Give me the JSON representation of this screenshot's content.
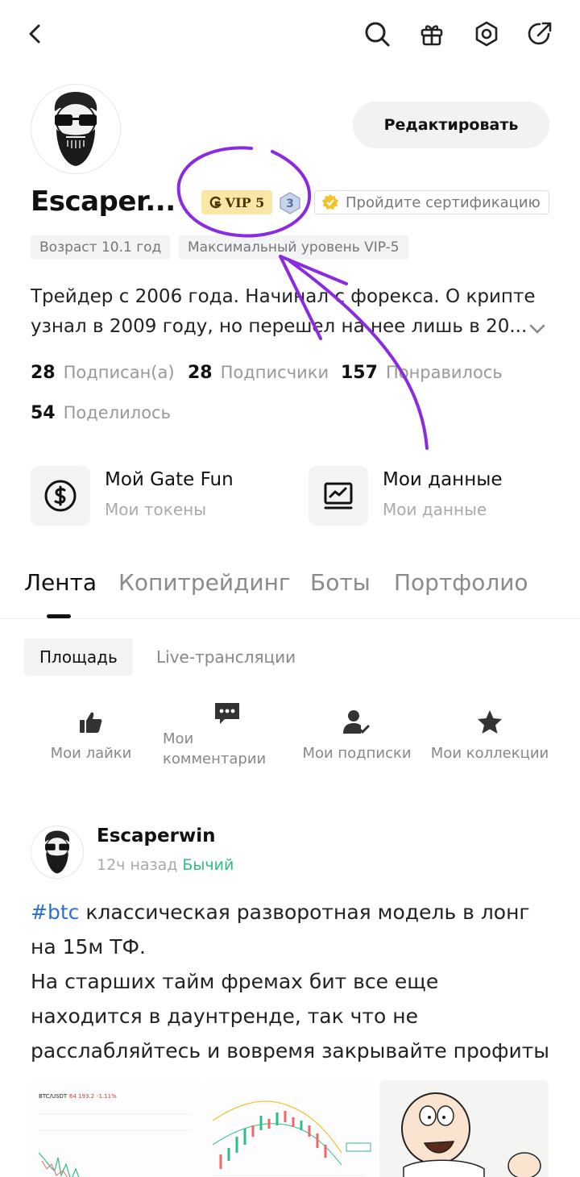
{
  "profile": {
    "username": "Escaper...",
    "edit_label": "Редактировать",
    "vip_label": "VIP 5",
    "level_number": "3",
    "certify_label": "Пройдите сертификацию",
    "age_chip": "Возраст 10.1 год",
    "vip_chip": "Максимальный уровень VIP-5",
    "bio": "Трейдер с 2006 года. Начинал с форекса. О крипте узнал в 2009 году, но перешел на нее лишь в 20..."
  },
  "stats": [
    {
      "value": "28",
      "label": "Подписан(а)"
    },
    {
      "value": "28",
      "label": "Подписчики"
    },
    {
      "value": "157",
      "label": "Понравилось"
    },
    {
      "value": "54",
      "label": "Поделилось"
    }
  ],
  "features": [
    {
      "title": "Мой Gate Fun",
      "subtitle": "Мои токены",
      "icon": "dollar-coin-icon"
    },
    {
      "title": "Мои данные",
      "subtitle": "Мои данные",
      "icon": "chart-monitor-icon"
    }
  ],
  "tabs": [
    {
      "label": "Лента",
      "active": true
    },
    {
      "label": "Копитрейдинг",
      "active": false
    },
    {
      "label": "Боты",
      "active": false
    },
    {
      "label": "Портфолио",
      "active": false
    }
  ],
  "subtabs": [
    {
      "label": "Площадь",
      "active": true
    },
    {
      "label": "Live-трансляции",
      "active": false
    }
  ],
  "actions": [
    {
      "label": "Мои лайки",
      "icon": "thumbs-up-icon"
    },
    {
      "label_line1": "Мои",
      "label_line2": "комментарии",
      "icon": "comment-icon"
    },
    {
      "label": "Мои подписки",
      "icon": "user-check-icon"
    },
    {
      "label": "Мои коллекции",
      "icon": "star-icon"
    }
  ],
  "post": {
    "author": "Escaperwin",
    "time": "12ч назад",
    "sentiment": "Бычий",
    "hashtag": "#btc",
    "text_line1_rest": " классическая разворотная модель в лонг на 15м ТФ.",
    "text_para2": "На старших тайм фремах бит все еще находится в даунтренде, так что не расслабляйтесь и вовремя закрывайте профиты от лонгов."
  },
  "thumbnails": {
    "chart_pair": "BTC/USDT",
    "chart_price": "64 193.2",
    "chart_change": "-1.11%"
  },
  "colors": {
    "accent_green": "#2ebd85",
    "hashtag_blue": "#2a6fdb",
    "vip_bg": "#fbe6a5",
    "annotation_purple": "#8a2be2"
  }
}
